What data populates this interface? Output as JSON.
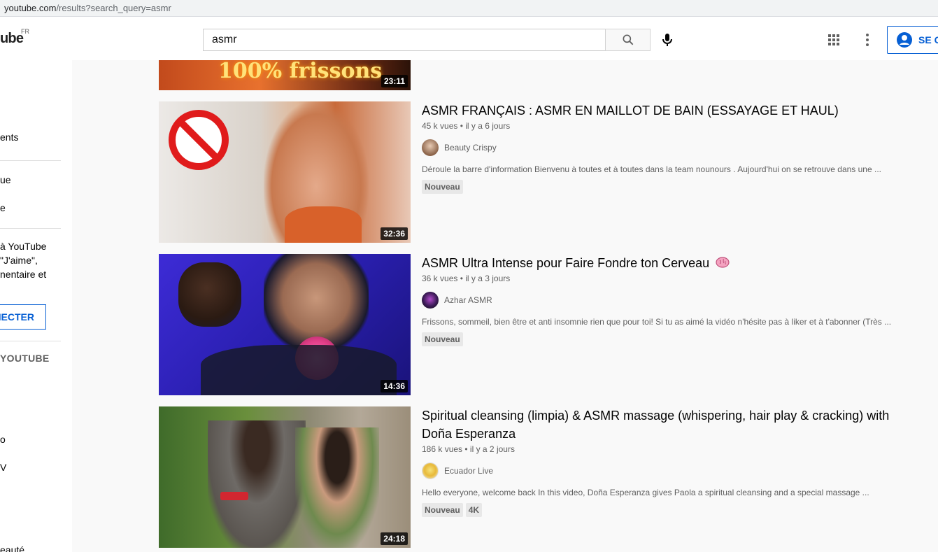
{
  "browser": {
    "url_host": "youtube.com",
    "url_path": "/results?search_query=asmr"
  },
  "header": {
    "logo_text": "ube",
    "region": "FR",
    "search_value": "asmr",
    "signin_label": "SE C"
  },
  "sidebar": {
    "items": [
      "ents",
      "ue",
      "e",
      "o",
      "V",
      "eauté"
    ],
    "promo": "à YouTube\n\"J'aime\",\nnentaire et",
    "connect_label": "NECTER",
    "section_heading": "YOUTUBE"
  },
  "videos": [
    {
      "thumb_text": "100% frissons",
      "duration": "23:11"
    },
    {
      "title": "ASMR FRANÇAIS : ASMR EN MAILLOT DE BAIN (ESSAYAGE ET HAUL)",
      "views": "45 k vues",
      "age": "il y a 6 jours",
      "channel": "Beauty Crispy",
      "description": "Déroule la barre d'information Bienvenu à toutes et à toutes dans la team nounours . Aujourd'hui on se retrouve dans une ...",
      "badges": [
        "Nouveau"
      ],
      "duration": "32:36"
    },
    {
      "title": "ASMR Ultra Intense pour Faire Fondre ton Cerveau",
      "views": "36 k vues",
      "age": "il y a 3 jours",
      "channel": "Azhar ASMR",
      "description": "Frissons, sommeil, bien être et anti insomnie rien que pour toi! Si tu as aimé la vidéo n'hésite pas à liker et à t'abonner (Très ...",
      "badges": [
        "Nouveau"
      ],
      "duration": "14:36"
    },
    {
      "title": "Spiritual cleansing (limpia) & ASMR massage (whispering, hair play & cracking) with Doña Esperanza",
      "views": "186 k vues",
      "age": "il y a 2 jours",
      "channel": "Ecuador Live",
      "description": "Hello everyone, welcome back In this video, Doña Esperanza gives Paola a spiritual cleansing and a special massage ...",
      "badges": [
        "Nouveau",
        "4K"
      ],
      "duration": "24:18"
    }
  ],
  "colors": {
    "accent": "#065fd4",
    "brand_red": "#ff0000"
  }
}
